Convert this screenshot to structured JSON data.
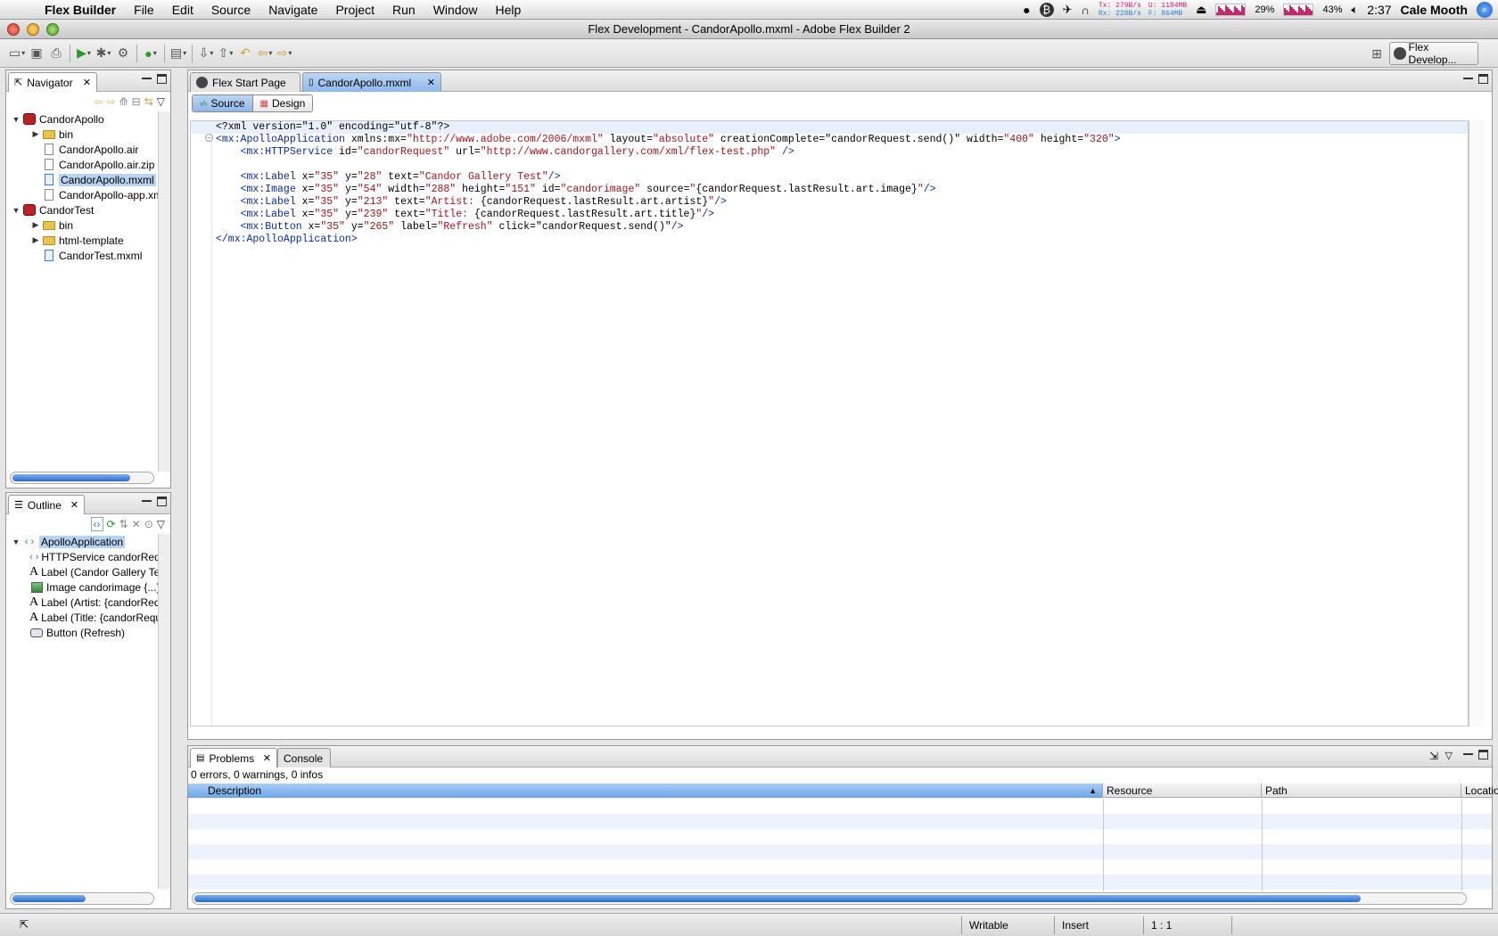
{
  "menubar": {
    "app": "Flex Builder",
    "items": [
      "File",
      "Edit",
      "Source",
      "Navigate",
      "Project",
      "Run",
      "Window",
      "Help"
    ],
    "net": {
      "tx_label": "Tx:",
      "tx": "279B/s",
      "rx_label": "Rx:",
      "rx": "228B/s",
      "u": "U: 1184MB",
      "f": "F:  864MB"
    },
    "cpu": "29%",
    "battery": "43%",
    "clock": "2:37",
    "user": "Cale Mooth"
  },
  "window": {
    "title": "Flex Development - CandorApollo.mxml - Adobe Flex Builder 2"
  },
  "toolbar": {
    "perspective": "Flex Develop..."
  },
  "navigator": {
    "title": "Navigator",
    "items": [
      {
        "label": "CandorApollo",
        "level": 0,
        "icon": "project-icon",
        "twisty": "▼"
      },
      {
        "label": "bin",
        "level": 1,
        "icon": "folder-icon",
        "twisty": "▶"
      },
      {
        "label": "CandorApollo.air",
        "level": 1,
        "icon": "file-icon",
        "twisty": ""
      },
      {
        "label": "CandorApollo.air.zip",
        "level": 1,
        "icon": "file-icon",
        "twisty": ""
      },
      {
        "label": "CandorApollo.mxml",
        "level": 1,
        "icon": "mxml-file-icon",
        "twisty": "",
        "selected": true
      },
      {
        "label": "CandorApollo-app.xml",
        "level": 1,
        "icon": "file-icon",
        "twisty": ""
      },
      {
        "label": "CandorTest",
        "level": 0,
        "icon": "project-icon",
        "twisty": "▼"
      },
      {
        "label": "bin",
        "level": 1,
        "icon": "folder-icon",
        "twisty": "▶"
      },
      {
        "label": "html-template",
        "level": 1,
        "icon": "folder-icon",
        "twisty": "▶"
      },
      {
        "label": "CandorTest.mxml",
        "level": 1,
        "icon": "mxml-file-icon",
        "twisty": ""
      }
    ]
  },
  "outline": {
    "title": "Outline",
    "items": [
      {
        "label": "ApolloApplication",
        "level": 0,
        "icon": "tag-icon",
        "selected": true
      },
      {
        "label": "HTTPService candorRequest",
        "level": 1,
        "icon": "tag-icon"
      },
      {
        "label": "Label (Candor Gallery Test)",
        "level": 1,
        "icon": "label-icon"
      },
      {
        "label": "Image candorimage {...}",
        "level": 1,
        "icon": "image-icon"
      },
      {
        "label": "Label (Artist: {candorRequest.lastResult.art.artist})",
        "level": 1,
        "icon": "label-icon"
      },
      {
        "label": "Label (Title: {candorRequest.lastResult.art.title})",
        "level": 1,
        "icon": "label-icon"
      },
      {
        "label": "Button (Refresh)",
        "level": 1,
        "icon": "button-icon"
      }
    ]
  },
  "editor": {
    "tabs": [
      {
        "label": "Flex Start Page"
      },
      {
        "label": "CandorApollo.mxml",
        "active": true
      }
    ],
    "modes": {
      "source": "Source",
      "design": "Design"
    },
    "lines": [
      [
        {
          "c": "pi",
          "t": "<?xml version=\"1.0\" encoding=\"utf-8\"?>"
        }
      ],
      [
        {
          "c": "tag",
          "t": "<mx:ApolloApplication"
        },
        {
          "c": "attr",
          "t": " xmlns:mx="
        },
        {
          "c": "val",
          "t": "\"http://www.adobe.com/2006/mxml\""
        },
        {
          "c": "attr",
          "t": " layout="
        },
        {
          "c": "val",
          "t": "\"absolute\""
        },
        {
          "c": "attr",
          "t": " creationComplete="
        },
        {
          "c": "attr",
          "t": "\"candorRequest.send()\""
        },
        {
          "c": "attr",
          "t": " width="
        },
        {
          "c": "val",
          "t": "\"400\""
        },
        {
          "c": "attr",
          "t": " height="
        },
        {
          "c": "val",
          "t": "\"320\""
        },
        {
          "c": "tag",
          "t": ">"
        }
      ],
      [
        {
          "c": "tag",
          "t": "    <mx:HTTPService"
        },
        {
          "c": "attr",
          "t": " id="
        },
        {
          "c": "val",
          "t": "\"candorRequest\""
        },
        {
          "c": "attr",
          "t": " url="
        },
        {
          "c": "val",
          "t": "\"http://www.candorgallery.com/xml/flex-test.php\""
        },
        {
          "c": "tag",
          "t": " />"
        }
      ],
      [],
      [
        {
          "c": "tag",
          "t": "    <mx:Label"
        },
        {
          "c": "attr",
          "t": " x="
        },
        {
          "c": "val",
          "t": "\"35\""
        },
        {
          "c": "attr",
          "t": " y="
        },
        {
          "c": "val",
          "t": "\"28\""
        },
        {
          "c": "attr",
          "t": " text="
        },
        {
          "c": "val",
          "t": "\"Candor Gallery Test\""
        },
        {
          "c": "tag",
          "t": "/>"
        }
      ],
      [
        {
          "c": "tag",
          "t": "    <mx:Image"
        },
        {
          "c": "attr",
          "t": " x="
        },
        {
          "c": "val",
          "t": "\"35\""
        },
        {
          "c": "attr",
          "t": " y="
        },
        {
          "c": "val",
          "t": "\"54\""
        },
        {
          "c": "attr",
          "t": " width="
        },
        {
          "c": "val",
          "t": "\"288\""
        },
        {
          "c": "attr",
          "t": " height="
        },
        {
          "c": "val",
          "t": "\"151\""
        },
        {
          "c": "attr",
          "t": " id="
        },
        {
          "c": "val",
          "t": "\"candorimage\""
        },
        {
          "c": "attr",
          "t": " source="
        },
        {
          "c": "val",
          "t": "\""
        },
        {
          "c": "attr",
          "t": "{candorRequest.lastResult.art.image}"
        },
        {
          "c": "val",
          "t": "\""
        },
        {
          "c": "tag",
          "t": "/>"
        }
      ],
      [
        {
          "c": "tag",
          "t": "    <mx:Label"
        },
        {
          "c": "attr",
          "t": " x="
        },
        {
          "c": "val",
          "t": "\"35\""
        },
        {
          "c": "attr",
          "t": " y="
        },
        {
          "c": "val",
          "t": "\"213\""
        },
        {
          "c": "attr",
          "t": " text="
        },
        {
          "c": "val",
          "t": "\"Artist: "
        },
        {
          "c": "attr",
          "t": "{candorRequest.lastResult.art.artist}"
        },
        {
          "c": "val",
          "t": "\""
        },
        {
          "c": "tag",
          "t": "/>"
        }
      ],
      [
        {
          "c": "tag",
          "t": "    <mx:Label"
        },
        {
          "c": "attr",
          "t": " x="
        },
        {
          "c": "val",
          "t": "\"35\""
        },
        {
          "c": "attr",
          "t": " y="
        },
        {
          "c": "val",
          "t": "\"239\""
        },
        {
          "c": "attr",
          "t": " text="
        },
        {
          "c": "val",
          "t": "\"Title: "
        },
        {
          "c": "attr",
          "t": "{candorRequest.lastResult.art.title}"
        },
        {
          "c": "val",
          "t": "\""
        },
        {
          "c": "tag",
          "t": "/>"
        }
      ],
      [
        {
          "c": "tag",
          "t": "    <mx:Button"
        },
        {
          "c": "attr",
          "t": " x="
        },
        {
          "c": "val",
          "t": "\"35\""
        },
        {
          "c": "attr",
          "t": " y="
        },
        {
          "c": "val",
          "t": "\"265\""
        },
        {
          "c": "attr",
          "t": " label="
        },
        {
          "c": "val",
          "t": "\"Refresh\""
        },
        {
          "c": "attr",
          "t": " click="
        },
        {
          "c": "attr",
          "t": "\"candorRequest.send()\""
        },
        {
          "c": "tag",
          "t": "/>"
        }
      ],
      [
        {
          "c": "tag",
          "t": "</mx:ApolloApplication>"
        }
      ]
    ]
  },
  "problems": {
    "tabs": [
      {
        "label": "Problems",
        "active": true
      },
      {
        "label": "Console"
      }
    ],
    "summary": "0 errors, 0 warnings, 0 infos",
    "columns": [
      "Description",
      "Resource",
      "Path",
      "Location"
    ]
  },
  "status": {
    "writable": "Writable",
    "mode": "Insert",
    "position": "1 : 1"
  },
  "colors": {
    "selection": "#b8d2f1",
    "tag": "#0a2aa6",
    "value": "#a0151b",
    "accent": "#3d7fd8"
  }
}
